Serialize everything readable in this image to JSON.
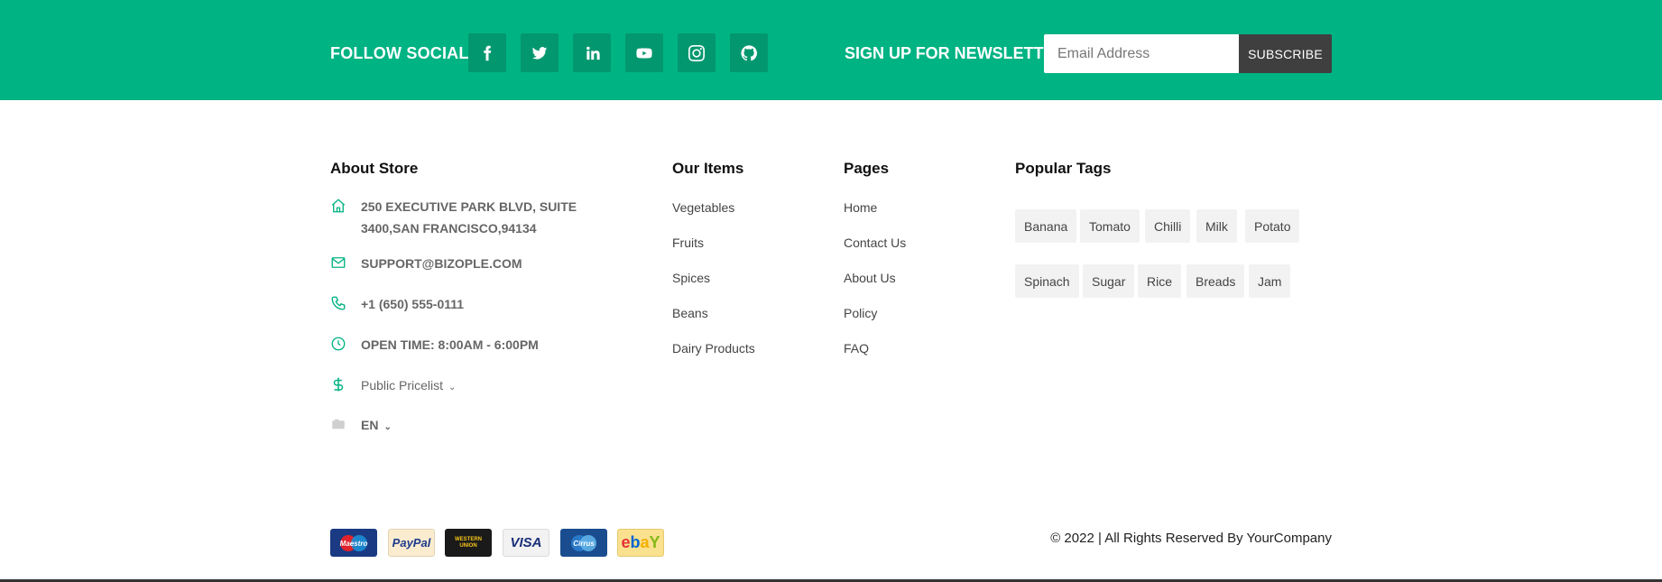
{
  "socials": {
    "title": "FOLLOW SOCIALS",
    "icons": [
      "facebook-icon",
      "twitter-icon",
      "linkedin-icon",
      "youtube-icon",
      "instagram-icon",
      "github-icon"
    ]
  },
  "newsletter": {
    "title": "SIGN UP FOR NEWSLETTER",
    "email_placeholder": "Email Address",
    "email_value": "",
    "subscribe_label": "SUBSCRIBE"
  },
  "about": {
    "title": "About Store",
    "address": "250 EXECUTIVE PARK BLVD, SUITE 3400,SAN FRANCISCO,94134",
    "email": "SUPPORT@BIZOPLE.COM",
    "phone": "+1 (650) 555-0111",
    "hours": "OPEN TIME: 8:00AM - 6:00PM",
    "pricelist": "Public Pricelist",
    "language": "EN"
  },
  "items": {
    "title": "Our Items",
    "links": [
      "Vegetables",
      "Fruits",
      "Spices",
      "Beans",
      "Dairy Products"
    ]
  },
  "pages": {
    "title": "Pages",
    "links": [
      "Home",
      "Contact Us",
      "About Us",
      "Policy",
      "FAQ"
    ]
  },
  "tags": {
    "title": "Popular Tags",
    "row1": [
      "Banana",
      "Tomato",
      "Chilli",
      "Milk",
      "Potato"
    ],
    "row2": [
      "Spinach",
      "Sugar",
      "Rice",
      "Breads",
      "Jam"
    ]
  },
  "payments": {
    "maestro": "Maestro",
    "paypal": "PayPal",
    "western_union": "WESTERN UNION",
    "visa": "VISA",
    "cirrus": "Cirrus",
    "ebay_e": "e",
    "ebay_b": "b",
    "ebay_a": "a",
    "ebay_y": "Y"
  },
  "copyright": "© 2022 | All Rights Reserved By YourCompany",
  "colors": {
    "brand": "#00b383",
    "social_button": "#03976f",
    "subscribe": "#3f3f3f",
    "tag_bg": "#f2f2f2"
  }
}
